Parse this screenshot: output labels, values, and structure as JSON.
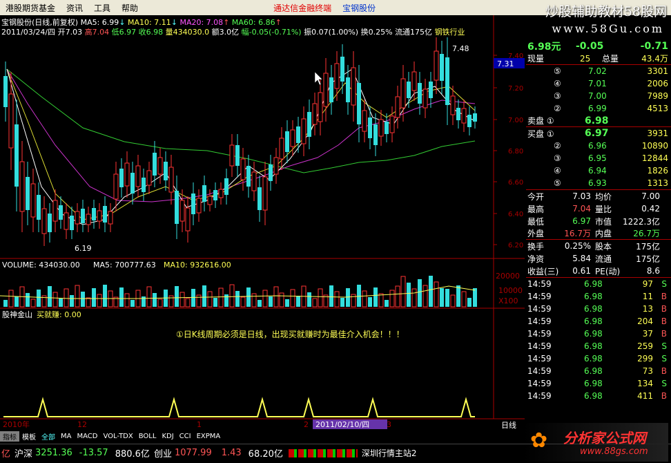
{
  "menu": {
    "items": [
      "港股期货基金",
      "资讯",
      "工具",
      "帮助"
    ],
    "link1": "通达信金融终端",
    "link2": "宝钢股份"
  },
  "watermark": {
    "text1": "炒股辅助教材58股网",
    "text2": "www.58Gu.com"
  },
  "stock": {
    "title": "宝钢股份(日线,前复权)",
    "ma5": "MA5: 6.99",
    "ma10": "MA10: 7.11",
    "ma20": "MA20: 7.08",
    "ma60": "MA60: 6.86",
    "date": "2011/03/24/四",
    "open": "开7.03",
    "high": "高7.04",
    "low": "低6.97",
    "close": "收6.98",
    "vol": "量434030.0",
    "amt": "额3.0亿",
    "chg": "幅-0.05(-0.71%)",
    "amp": "振0.07(1.00%)",
    "turn": "换0.25%",
    "float": "流通175亿",
    "industry": "钢铁行业"
  },
  "chart_data": [
    {
      "type": "candlestick",
      "yticks": [
        "7.40",
        "7.20",
        "7.00",
        "6.80",
        "6.60",
        "6.40",
        "6.20"
      ],
      "high_label": "7.48",
      "low_label": "6.19",
      "cur_price": "7.31",
      "x_labels": [
        "2010年",
        "12",
        "1",
        "2",
        "3"
      ],
      "date_box": "2011/02/10/四"
    },
    {
      "type": "bar",
      "legend": [
        "VOLUME: 434030.00",
        "MA5: 700777.63",
        "MA10: 932616.00"
      ],
      "yticks": [
        "20000",
        "10000",
        "X100"
      ]
    },
    {
      "type": "line",
      "legend": [
        "股神金山",
        "买就赚: 0.00"
      ],
      "note": "①日K线周期必须是日线，出现买就赚时为最佳介入机会！！！",
      "label": "日线"
    }
  ],
  "quote": {
    "price": "6.98元",
    "change": "-0.05",
    "pct": "-0.71",
    "xl_label": "现量",
    "xl": "25",
    "zl_label": "总量",
    "zl": "43.4万",
    "sell": [
      {
        "n": "⑤",
        "p": "7.02",
        "v": "3301"
      },
      {
        "n": "④",
        "p": "7.01",
        "v": "2006"
      },
      {
        "n": "③",
        "p": "7.00",
        "v": "7989"
      },
      {
        "n": "②",
        "p": "6.99",
        "v": "4513"
      }
    ],
    "sell1_label": "卖盘 ①",
    "sell1_p": "6.98",
    "buy1_label": "买盘 ①",
    "buy1_p": "6.97",
    "buy1_v": "3931",
    "buy": [
      {
        "n": "②",
        "p": "6.96",
        "v": "10890"
      },
      {
        "n": "③",
        "p": "6.95",
        "v": "12844"
      },
      {
        "n": "④",
        "p": "6.94",
        "v": "1826"
      },
      {
        "n": "⑤",
        "p": "6.93",
        "v": "1313"
      }
    ],
    "stats": [
      [
        "今开",
        "7.03",
        "均价",
        "7.00"
      ],
      [
        "最高",
        "7.04",
        "量比",
        "0.42"
      ],
      [
        "最低",
        "6.97",
        "市值",
        "1222.3亿"
      ],
      [
        "外盘",
        "16.7万",
        "内盘",
        "26.7万"
      ],
      [
        "换手",
        "0.25%",
        "股本",
        "175亿"
      ],
      [
        "净资",
        "5.84",
        "流通",
        "175亿"
      ],
      [
        "收益(三)",
        "0.61",
        "PE(动)",
        "8.6"
      ]
    ],
    "ticks": [
      [
        "14:59",
        "6.98",
        "97",
        "S"
      ],
      [
        "14:59",
        "6.98",
        "11",
        "B"
      ],
      [
        "14:59",
        "6.98",
        "13",
        "B"
      ],
      [
        "14:59",
        "6.98",
        "204",
        "B"
      ],
      [
        "14:59",
        "6.98",
        "37",
        "B"
      ],
      [
        "14:59",
        "6.98",
        "259",
        "S"
      ],
      [
        "14:59",
        "6.98",
        "299",
        "S"
      ],
      [
        "14:59",
        "6.98",
        "73",
        "B"
      ],
      [
        "14:59",
        "6.98",
        "134",
        "S"
      ],
      [
        "14:59",
        "6.98",
        "411",
        "B"
      ]
    ]
  },
  "bottom": {
    "tabs": [
      "指标",
      "模板",
      "全部",
      "MA",
      "MACD",
      "VOL-TDX",
      "BOLL",
      "KDJ",
      "CCI",
      "EXPMA"
    ],
    "sh": "沪深",
    "sh_val": "3251.36",
    "sh_chg": "-13.57",
    "sh_amt": "880.6亿",
    "cy": "创业",
    "cy_val": "1077.99",
    "cy_chg": "1.43",
    "cy_amt": "68.20亿",
    "server": "深圳行情主站2",
    "logo": "分析家公式网",
    "logo_url": "www.88gs.com"
  }
}
